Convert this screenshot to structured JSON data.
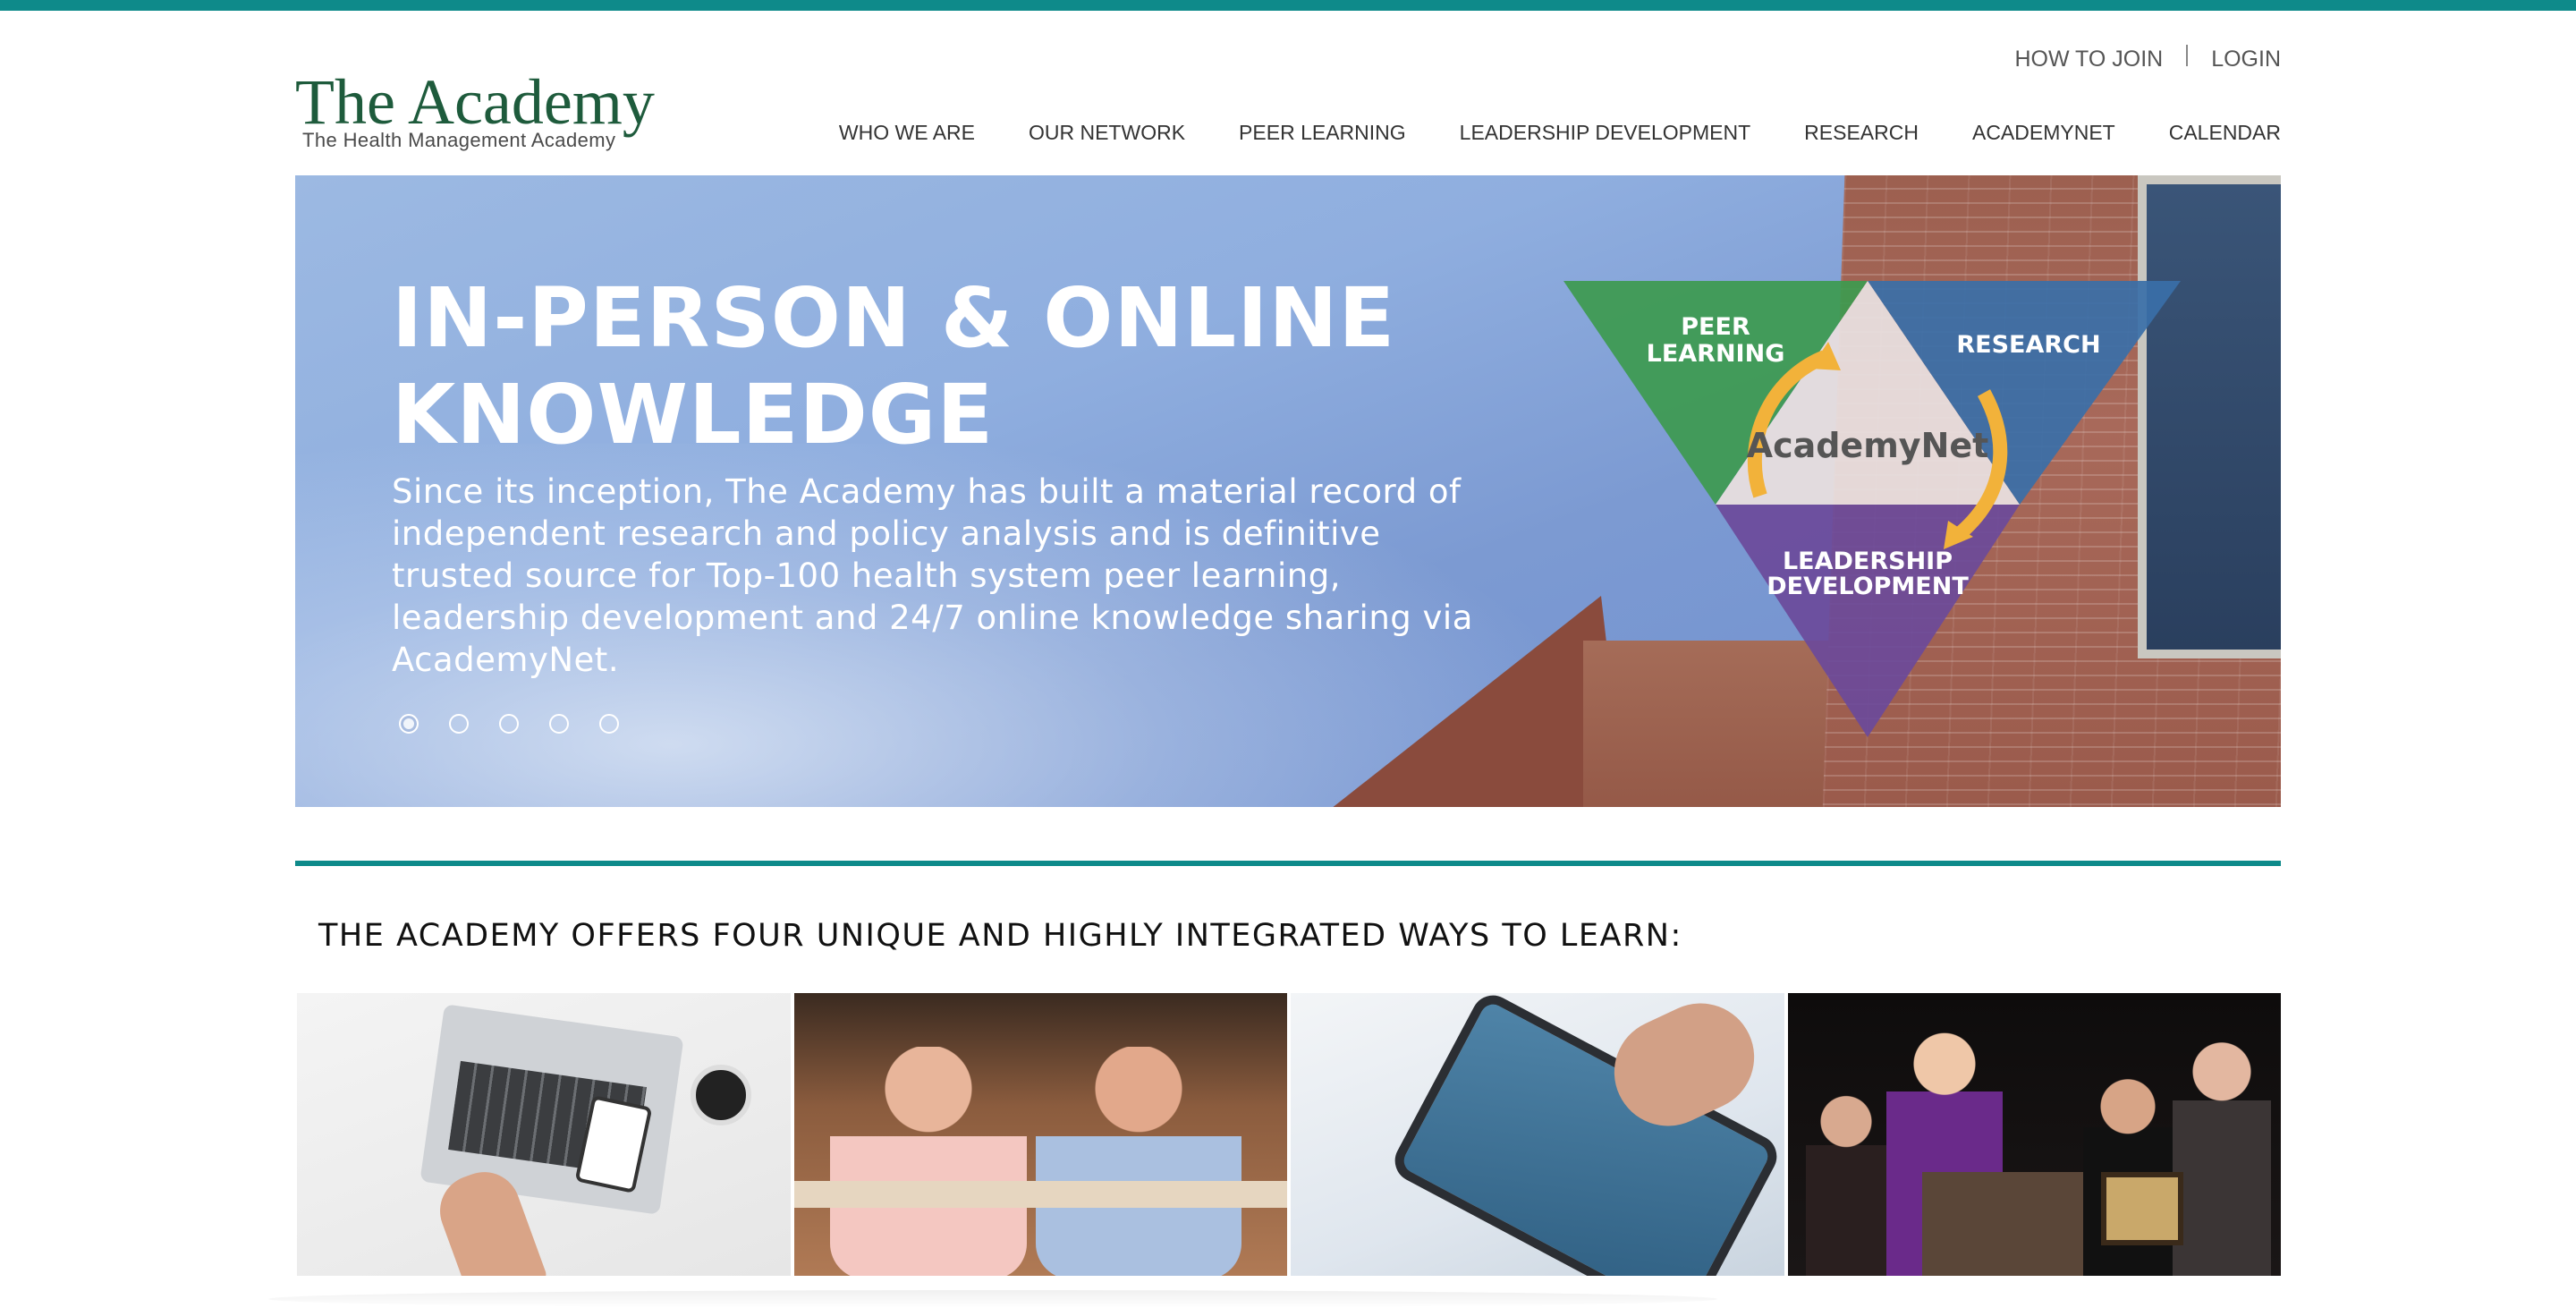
{
  "brand": {
    "title": "The Academy",
    "subtitle": "The Health Management Academy",
    "accent_color": "#0e8a8a"
  },
  "utility_nav": {
    "how_to_join": "HOW TO JOIN",
    "login": "LOGIN"
  },
  "main_nav": [
    {
      "label": "WHO WE ARE"
    },
    {
      "label": "OUR NETWORK"
    },
    {
      "label": "PEER LEARNING"
    },
    {
      "label": "LEADERSHIP DEVELOPMENT"
    },
    {
      "label": "RESEARCH"
    },
    {
      "label": "ACADEMYNET"
    },
    {
      "label": "CALENDAR"
    }
  ],
  "hero": {
    "heading_line1": "IN-PERSON & ONLINE",
    "heading_line2": "KNOWLEDGE",
    "body": "Since its inception, The Academy has built a material record of independent research and policy analysis and is definitive trusted source for Top-100 health system peer learning, leadership development and 24/7 online knowledge sharing via AcademyNet.",
    "slide_count": 5,
    "active_slide": 1,
    "graphic": {
      "peer_learning_line1": "PEER",
      "peer_learning_line2": "LEARNING",
      "research": "RESEARCH",
      "center": "AcademyNet",
      "leadership_line1": "LEADERSHIP",
      "leadership_line2": "DEVELOPMENT",
      "colors": {
        "peer_learning": "#3d9a4f",
        "research": "#3a6fa8",
        "leadership": "#6b4a9a",
        "center": "#e8dede",
        "arrow": "#f2b23a"
      }
    }
  },
  "section": {
    "heading": "THE ACADEMY OFFERS FOUR UNIQUE AND HIGHLY INTEGRATED WAYS TO LEARN:",
    "photos": [
      {
        "icon": "laptop-photo"
      },
      {
        "icon": "meeting-photo"
      },
      {
        "icon": "tablet-photo"
      },
      {
        "icon": "award-photo"
      }
    ]
  }
}
